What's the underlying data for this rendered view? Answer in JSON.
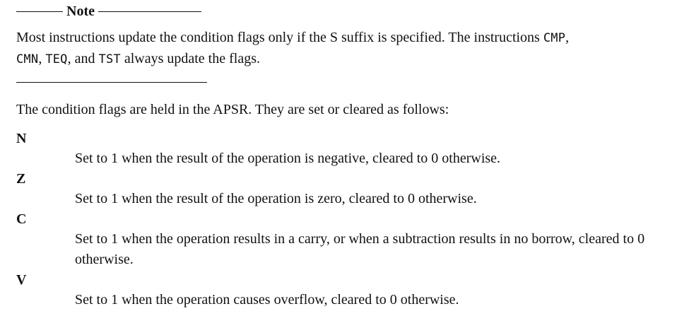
{
  "note": {
    "label": "Note",
    "text_1": "Most instructions update the condition flags only if the S suffix is specified. The instructions ",
    "code_1": "CMP",
    "sep_1": ",",
    "code_2": "CMN",
    "sep_2": ", ",
    "code_3": "TEQ",
    "sep_3": ", and ",
    "code_4": "TST",
    "text_2": " always update the flags."
  },
  "intro": "The condition flags are held in the APSR. They are set or cleared as follows:",
  "flags": [
    {
      "term": "N",
      "description": "Set to 1 when the result of the operation is negative, cleared to 0 otherwise."
    },
    {
      "term": "Z",
      "description": "Set to 1 when the result of the operation is zero, cleared to 0 otherwise."
    },
    {
      "term": "C",
      "description": "Set to 1 when the operation results in a carry, or when a subtraction results in no borrow, cleared to 0 otherwise."
    },
    {
      "term": "V",
      "description": "Set to 1 when the operation causes overflow, cleared to 0 otherwise."
    }
  ]
}
